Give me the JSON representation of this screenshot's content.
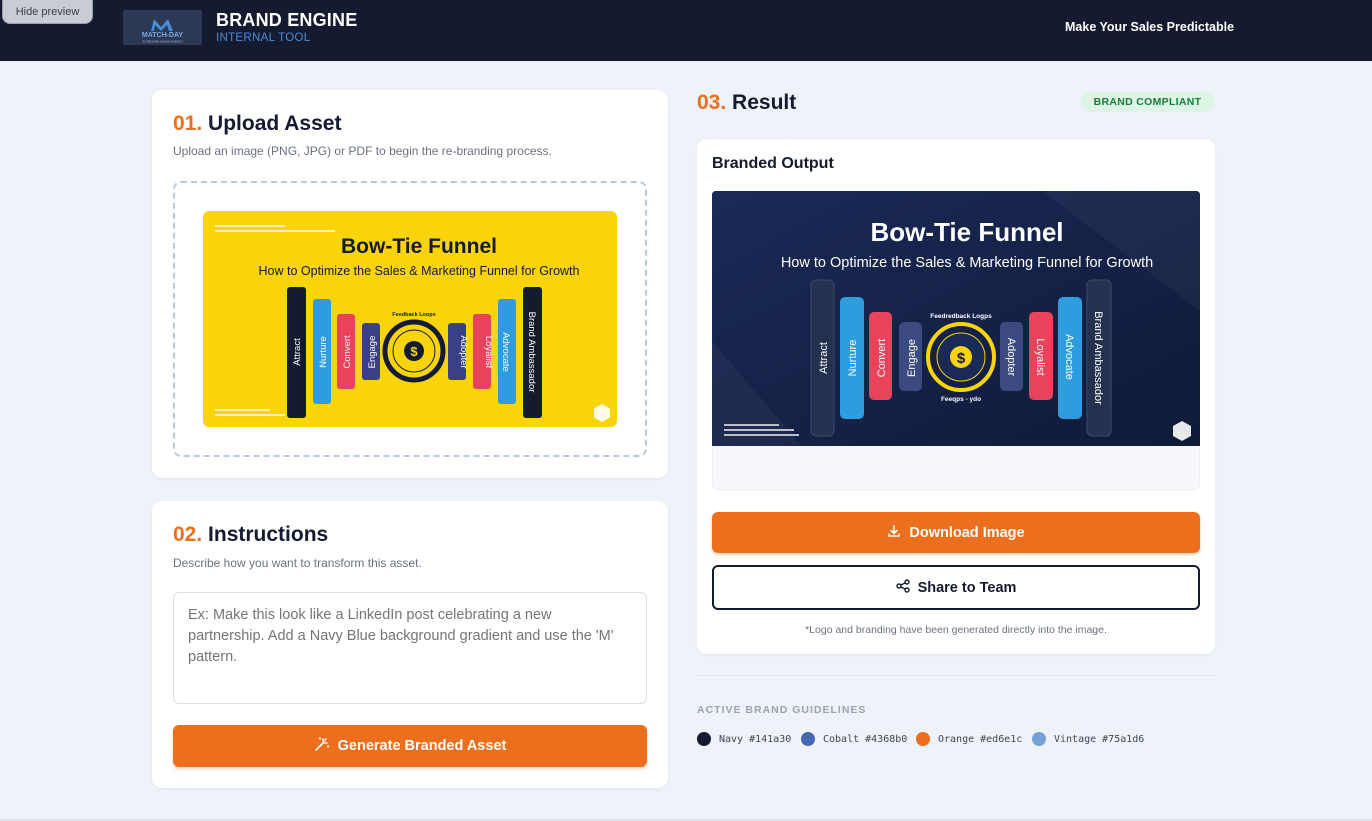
{
  "app": {
    "hide_preview": "Hide preview",
    "logo_text": "MATCH-DAY",
    "logo_sub": "OUTBOUND SALES AGENCY",
    "title": "BRAND ENGINE",
    "subtitle": "INTERNAL TOOL",
    "tagline": "Make Your Sales Predictable"
  },
  "upload": {
    "num": "01.",
    "title": "Upload Asset",
    "desc": "Upload an image (PNG, JPG) or PDF to begin the re-branding process."
  },
  "instructions": {
    "num": "02.",
    "title": "Instructions",
    "desc": "Describe how you want to transform this asset.",
    "placeholder": "Ex: Make this look like a LinkedIn post celebrating a new partnership. Add a Navy Blue background gradient and use the 'M' pattern.",
    "generate_label": "Generate Branded Asset"
  },
  "result": {
    "num": "03.",
    "title": "Result",
    "badge": "BRAND COMPLIANT",
    "output_label": "Branded Output",
    "download_label": "Download Image",
    "share_label": "Share to Team",
    "footnote": "*Logo and branding have been generated directly into the image."
  },
  "asset": {
    "title": "Bow-Tie Funnel",
    "subtitle": "How to Optimize the Sales & Marketing Funnel for Growth",
    "left_stages": [
      "Attract",
      "Nurture",
      "Convert",
      "Engage"
    ],
    "right_stages": [
      "Adopter",
      "Loyalist",
      "Advocate",
      "Brand Ambassador"
    ],
    "loop_label": "Feedback Loops",
    "loop_label_output": "Feedredback Logps",
    "loop_bottom_output": "Feeqps - ydo",
    "symbol": "$"
  },
  "guidelines": {
    "label": "ACTIVE BRAND GUIDELINES",
    "colors": [
      {
        "text": "Navy #141a30",
        "hex": "#141a30"
      },
      {
        "text": "Cobalt #4368b0",
        "hex": "#4368b0"
      },
      {
        "text": "Orange #ed6e1c",
        "hex": "#ed6e1c"
      },
      {
        "text": "Vintage #75a1d6",
        "hex": "#75a1d6"
      }
    ]
  }
}
